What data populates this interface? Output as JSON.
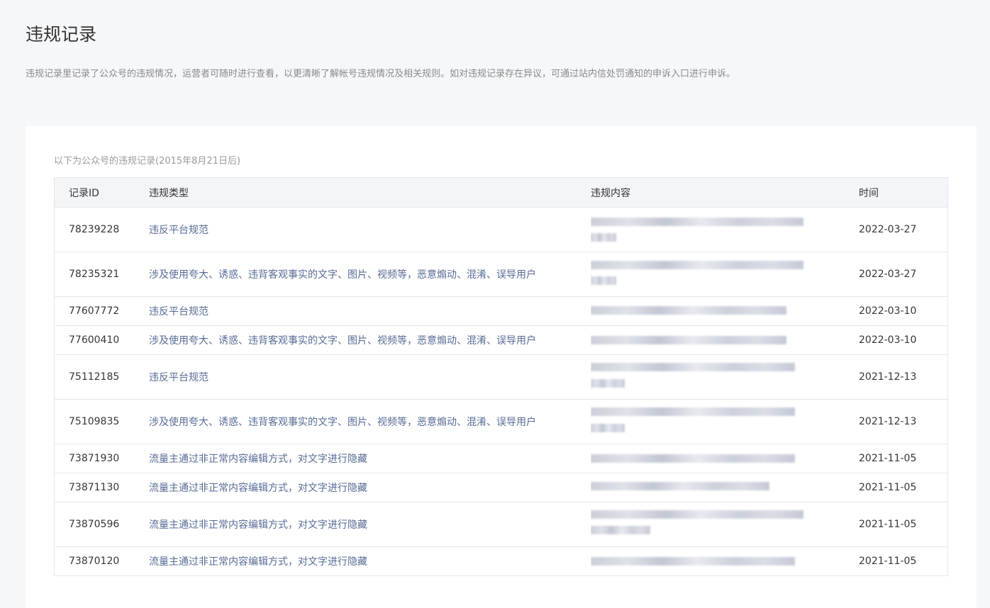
{
  "page": {
    "title": "违规记录",
    "description": "违规记录里记录了公众号的违规情况，运营者可随时进行查看，以更清晰了解帐号违规情况及相关规则。如对违规记录存在异议，可通过站内信处罚通知的申诉入口进行申诉。"
  },
  "table": {
    "caption": "以下为公众号的违规记录(2015年8月21日后)",
    "headers": {
      "id": "记录ID",
      "type": "违规类型",
      "content": "违规内容",
      "time": "时间"
    },
    "rows": [
      {
        "id": "78239228",
        "type": "违反平台规范",
        "time": "2022-03-27"
      },
      {
        "id": "78235321",
        "type": "涉及使用夸大、诱惑、违背客观事实的文字、图片、视频等，恶意煽动、混淆、误导用户",
        "time": "2022-03-27"
      },
      {
        "id": "77607772",
        "type": "违反平台规范",
        "time": "2022-03-10"
      },
      {
        "id": "77600410",
        "type": "涉及使用夸大、诱惑、违背客观事实的文字、图片、视频等，恶意煽动、混淆、误导用户",
        "time": "2022-03-10"
      },
      {
        "id": "75112185",
        "type": "违反平台规范",
        "time": "2021-12-13"
      },
      {
        "id": "75109835",
        "type": "涉及使用夸大、诱惑、违背客观事实的文字、图片、视频等，恶意煽动、混淆、误导用户",
        "time": "2021-12-13"
      },
      {
        "id": "73871930",
        "type": "流量主通过非正常内容编辑方式，对文字进行隐藏",
        "time": "2021-11-05"
      },
      {
        "id": "73871130",
        "type": "流量主通过非正常内容编辑方式，对文字进行隐藏",
        "time": "2021-11-05"
      },
      {
        "id": "73870596",
        "type": "流量主通过非正常内容编辑方式，对文字进行隐藏",
        "time": "2021-11-05"
      },
      {
        "id": "73870120",
        "type": "流量主通过非正常内容编辑方式，对文字进行隐藏",
        "time": "2021-11-05"
      }
    ]
  }
}
